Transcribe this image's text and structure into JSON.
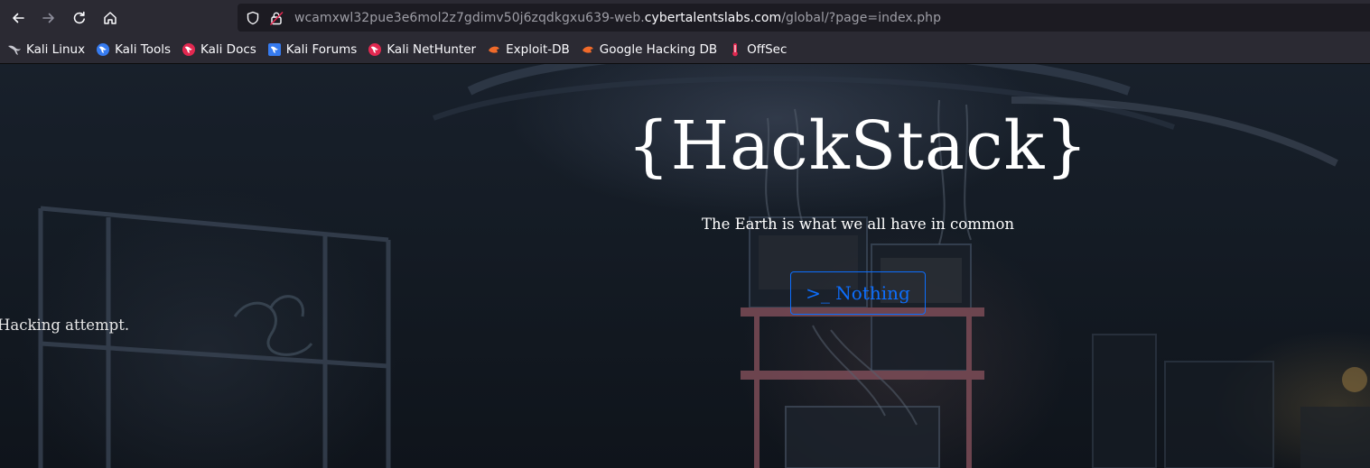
{
  "browser": {
    "url_prefix": "wcamxwl32pue3e6mol2z7gdimv50j6zqdkgxu639-web.",
    "url_domain": "cybertalentslabs.com",
    "url_path": "/global/?page=index.php"
  },
  "bookmarks": [
    {
      "label": "Kali Linux",
      "icon": "kali-dragon-icon"
    },
    {
      "label": "Kali Tools",
      "icon": "kali-tools-icon"
    },
    {
      "label": "Kali Docs",
      "icon": "kali-docs-icon"
    },
    {
      "label": "Kali Forums",
      "icon": "kali-forums-icon"
    },
    {
      "label": "Kali NetHunter",
      "icon": "kali-nethunter-icon"
    },
    {
      "label": "Exploit-DB",
      "icon": "exploit-db-icon"
    },
    {
      "label": "Google Hacking DB",
      "icon": "ghdb-icon"
    },
    {
      "label": "OffSec",
      "icon": "offsec-icon"
    }
  ],
  "page": {
    "title": "{HackStack}",
    "tagline": "The Earth is what we all have in common",
    "button_label": ">_ Nothing",
    "message": "Hacking attempt."
  },
  "colors": {
    "toolbar_bg": "#2b2a33",
    "urlbar_bg": "#1c1b22",
    "button_accent": "#0d6efd",
    "title_text": "#ffffff"
  }
}
